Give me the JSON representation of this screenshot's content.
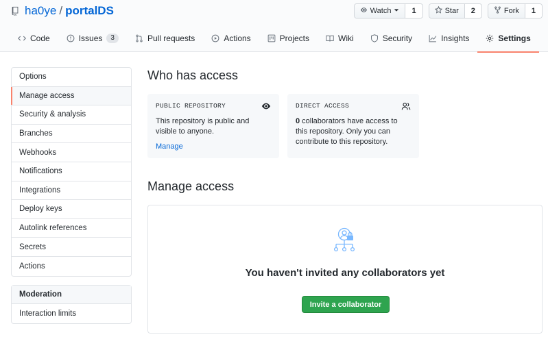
{
  "repo": {
    "owner": "ha0ye",
    "separator": "/",
    "name": "portalDS"
  },
  "actions": {
    "watch": {
      "label": "Watch",
      "count": "1"
    },
    "star": {
      "label": "Star",
      "count": "2"
    },
    "fork": {
      "label": "Fork",
      "count": "1"
    }
  },
  "tabs": [
    {
      "label": "Code",
      "icon": "code-icon"
    },
    {
      "label": "Issues",
      "icon": "issue-icon",
      "counter": "3"
    },
    {
      "label": "Pull requests",
      "icon": "pull-request-icon"
    },
    {
      "label": "Actions",
      "icon": "play-icon"
    },
    {
      "label": "Projects",
      "icon": "project-icon"
    },
    {
      "label": "Wiki",
      "icon": "book-icon"
    },
    {
      "label": "Security",
      "icon": "shield-icon"
    },
    {
      "label": "Insights",
      "icon": "graph-icon"
    },
    {
      "label": "Settings",
      "icon": "gear-icon",
      "selected": true
    }
  ],
  "sidebar": {
    "items": [
      {
        "label": "Options"
      },
      {
        "label": "Manage access",
        "active": true
      },
      {
        "label": "Security & analysis"
      },
      {
        "label": "Branches"
      },
      {
        "label": "Webhooks"
      },
      {
        "label": "Notifications"
      },
      {
        "label": "Integrations"
      },
      {
        "label": "Deploy keys"
      },
      {
        "label": "Autolink references"
      },
      {
        "label": "Secrets"
      },
      {
        "label": "Actions"
      }
    ],
    "moderation": {
      "heading": "Moderation",
      "items": [
        {
          "label": "Interaction limits"
        }
      ]
    }
  },
  "who_has_access": {
    "title": "Who has access",
    "public_card": {
      "label": "PUBLIC REPOSITORY",
      "text": "This repository is public and visible to anyone.",
      "link": "Manage"
    },
    "direct_card": {
      "label": "DIRECT ACCESS",
      "count": "0",
      "text": " collaborators have access to this repository. Only you can contribute to this repository."
    }
  },
  "manage_access": {
    "title": "Manage access",
    "empty_message": "You haven't invited any collaborators yet",
    "invite_button": "Invite a collaborator"
  },
  "colors": {
    "link": "#0366d6",
    "accent_underline": "#f9826c",
    "primary_button": "#2ea44f",
    "empty_icon": "#79b8ff"
  }
}
